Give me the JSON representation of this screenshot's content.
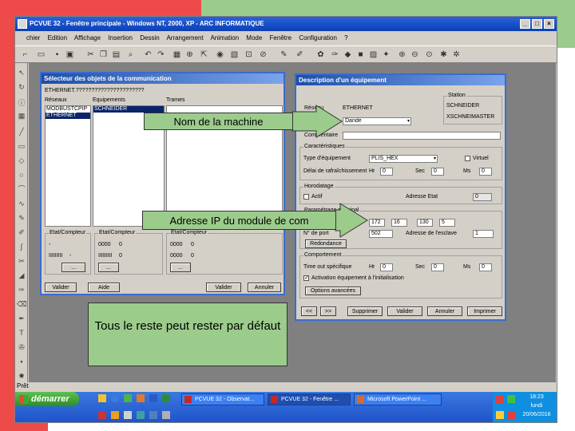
{
  "window": {
    "title": "PCVUE 32 - Fenêtre principale - Windows NT, 2000, XP - ARC INFORMATIQUE",
    "min": "_",
    "max": "□",
    "close": "×"
  },
  "menu": [
    "chier",
    "Edition",
    "Affichage",
    "Insertion",
    "Dessin",
    "Arrangement",
    "Animation",
    "Mode",
    "Fenêtre",
    "Configuration",
    "?"
  ],
  "status_text": "Prêt",
  "selector": {
    "title": "Sélecteur des objets de la communication",
    "path": "ETHERNET.??????????????????????",
    "col_reseaux": "Réseaux",
    "col_equipements": "Equipements",
    "col_trames": "Trames",
    "reseaux_items": [
      "MODBUSTCPIP",
      "ETHERNET"
    ],
    "equipement_items": [
      "SCHNEIDER"
    ],
    "stat_labels": [
      "Etat/Compteur",
      "Etat/Compteur",
      "Etat/Compteur"
    ],
    "stat_values": [
      [
        "-",
        "0"
      ],
      [
        "0000",
        "0"
      ],
      [
        "0000",
        "0"
      ]
    ],
    "stat_values2": [
      [
        "IIIIIIIII",
        "-"
      ],
      [
        "IIIIIIIII",
        "0"
      ],
      [
        "0000",
        "0"
      ]
    ],
    "dots": "...",
    "btn_valider": "Valider",
    "btn_aide": "Aide",
    "btn_valider2": "Valider",
    "btn_annuler": "Annuler"
  },
  "equip": {
    "title": "Description d'un équipement",
    "reseau_label": "Réseau",
    "reseau_value": "ETHERNET",
    "station_label": "Station",
    "station_items": [
      "SCHNEIDER",
      "XSCHNEIMASTER"
    ],
    "nom_label": "Nom",
    "nom_value": "Dande",
    "commentaire_label": "Commentaire",
    "carac_title": "Caractéristiques",
    "type_label": "Type d'équipement",
    "type_value": "PLIS_HEX",
    "virtuel_label": "Virtuel",
    "delai_label": "Délai de rafraîchissement",
    "hr_label": "Hr",
    "hr_value": "0",
    "sec_label": "Sec",
    "sec_value": "0",
    "ms_label": "Ms",
    "ms_value": "0",
    "horod_title": "Horodatage",
    "actif_label": "Actif",
    "adresse_label": "Adresse Etat",
    "adresse_value": "0",
    "param_title": "Paramétrage principal",
    "ip": [
      "172",
      "16",
      "130",
      "5"
    ],
    "port_label": "N° de port",
    "port_value": "502",
    "adr_esclave_label": "Adresse de l'esclave",
    "adr_esclave_value": "1",
    "redondance_btn": "Redondance",
    "comport_title": "Comportement",
    "timeout_label": "Time out spécifique",
    "tm_hr": "0",
    "tm_sec": "0",
    "tm_ms": "0",
    "auto_label": "Activation équipement à l'initialisation",
    "options_btn": "Options avancées",
    "btn_prev": "<<",
    "btn_next": ">>",
    "btn_suppr": "Supprimer",
    "btn_valider": "Valider",
    "btn_annuler": "Annuler",
    "btn_imprimer": "Imprimer"
  },
  "taskbar": {
    "start": "démarrer",
    "tasks": [
      "PCVUE 32 - Observat...",
      "PCVUE 32 - Fenêtre ...",
      "Microsoft PowerPoint ..."
    ],
    "time": "18:23",
    "day": "lundi",
    "date": "20/06/2016"
  },
  "callouts": {
    "nom": "Nom de la machine",
    "ip": "Adresse IP du module de com",
    "defaut": "Tous le reste peut rester par défaut"
  }
}
